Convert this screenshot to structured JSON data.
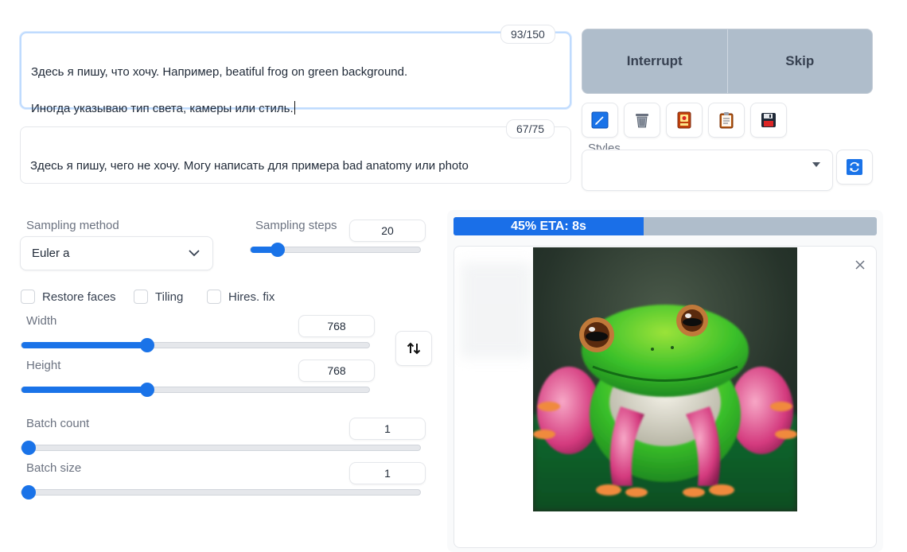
{
  "prompt": {
    "positive_line1": "Здесь я пишу, что хочу. Например, beatiful frog on green background.",
    "positive_line2": "Иногда указываю тип света, камеры или стиль.",
    "positive_counter": "93/150",
    "negative_text": "Здесь я пишу, чего не хочу. Могу написать для примера bad anatomy или photo",
    "negative_counter": "67/75"
  },
  "actions": {
    "interrupt_label": "Interrupt",
    "skip_label": "Skip"
  },
  "tools": [
    "edit-icon",
    "trash-icon",
    "card-icon",
    "clipboard-icon",
    "save-icon"
  ],
  "styles": {
    "label": "Styles",
    "value": ""
  },
  "sampling": {
    "method_label": "Sampling method",
    "method_value": "Euler a",
    "steps_label": "Sampling steps",
    "steps_value": "20",
    "steps_fraction": 0.13
  },
  "checkboxes": {
    "restore_faces": "Restore faces",
    "tiling": "Tiling",
    "hires_fix": "Hires. fix"
  },
  "size": {
    "width_label": "Width",
    "width_value": "768",
    "width_fraction": 0.36,
    "height_label": "Height",
    "height_value": "768",
    "height_fraction": 0.36
  },
  "batch": {
    "count_label": "Batch count",
    "count_value": "1",
    "size_label": "Batch size",
    "size_value": "1"
  },
  "progress": {
    "text": "45% ETA: 8s",
    "percent": 45
  },
  "colors": {
    "accent": "#1a73e8",
    "button_bg": "#afbdcb"
  }
}
